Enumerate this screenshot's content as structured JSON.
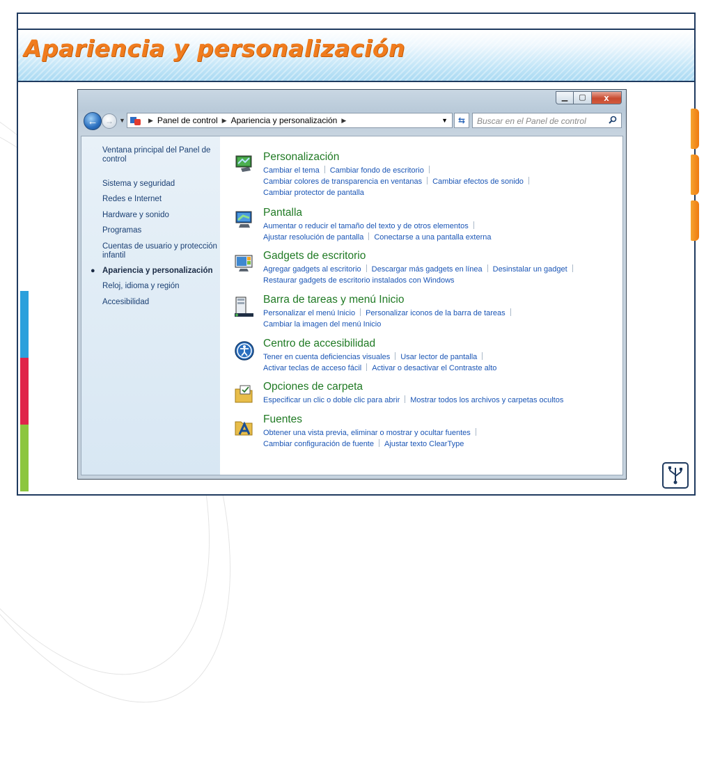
{
  "slide": {
    "title": "Apariencia y personalización",
    "accent_color": "#f07c1e",
    "frame_color": "#1f3a5f"
  },
  "window": {
    "controls": {
      "minimize_icon": "minimize-icon",
      "maximize_icon": "maximize-icon",
      "close_icon": "close-icon",
      "close_glyph": "x"
    },
    "address": {
      "crumbs": [
        "Panel de control",
        "Apariencia y personalización"
      ],
      "search_placeholder": "Buscar en el Panel de control"
    }
  },
  "sidebar": {
    "items": [
      {
        "label": "Ventana principal del Panel de control",
        "active": false
      },
      {
        "label": "Sistema y seguridad",
        "active": false
      },
      {
        "label": "Redes e Internet",
        "active": false
      },
      {
        "label": "Hardware y sonido",
        "active": false
      },
      {
        "label": "Programas",
        "active": false
      },
      {
        "label": "Cuentas de usuario y protección infantil",
        "active": false
      },
      {
        "label": "Apariencia y personalización",
        "active": true
      },
      {
        "label": "Reloj, idioma y región",
        "active": false
      },
      {
        "label": "Accesibilidad",
        "active": false
      }
    ]
  },
  "categories": [
    {
      "title": "Personalización",
      "icon": "personalization-icon",
      "lines": [
        [
          "Cambiar el tema",
          "Cambiar fondo de escritorio"
        ],
        [
          "Cambiar colores de transparencia en ventanas",
          "Cambiar efectos de sonido"
        ],
        [
          "Cambiar protector de pantalla"
        ]
      ]
    },
    {
      "title": "Pantalla",
      "icon": "display-icon",
      "lines": [
        [
          "Aumentar o reducir el tamaño del texto y de otros elementos"
        ],
        [
          "Ajustar resolución de pantalla",
          "Conectarse a una pantalla externa"
        ]
      ]
    },
    {
      "title": "Gadgets de escritorio",
      "icon": "gadgets-icon",
      "lines": [
        [
          "Agregar gadgets al escritorio",
          "Descargar más gadgets en línea",
          "Desinstalar un gadget"
        ],
        [
          "Restaurar gadgets de escritorio instalados con Windows"
        ]
      ]
    },
    {
      "title": "Barra de tareas y menú Inicio",
      "icon": "taskbar-icon",
      "lines": [
        [
          "Personalizar el menú Inicio",
          "Personalizar iconos de la barra de tareas"
        ],
        [
          "Cambiar la imagen del menú Inicio"
        ]
      ]
    },
    {
      "title": "Centro de accesibilidad",
      "icon": "accessibility-icon",
      "lines": [
        [
          "Tener en cuenta deficiencias visuales",
          "Usar lector de pantalla"
        ],
        [
          "Activar teclas de acceso fácil",
          "Activar o desactivar el Contraste alto"
        ]
      ]
    },
    {
      "title": "Opciones de carpeta",
      "icon": "folder-options-icon",
      "lines": [
        [
          "Especificar un clic o doble clic para abrir",
          "Mostrar todos los archivos y carpetas ocultos"
        ]
      ]
    },
    {
      "title": "Fuentes",
      "icon": "fonts-icon",
      "lines": [
        [
          "Obtener una vista previa, eliminar o mostrar y ocultar fuentes"
        ],
        [
          "Cambiar configuración de fuente",
          "Ajustar texto ClearType"
        ]
      ]
    }
  ]
}
